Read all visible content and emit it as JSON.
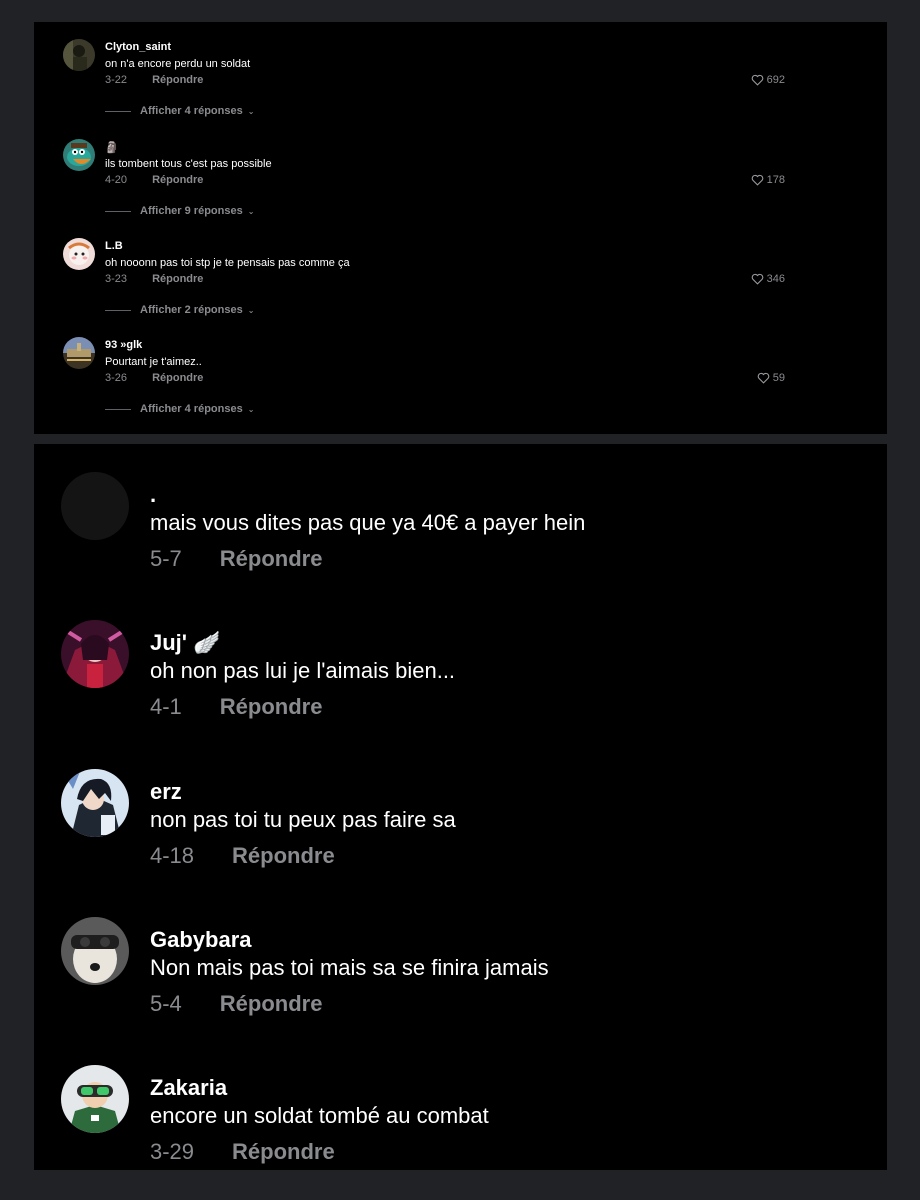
{
  "top_comments": [
    {
      "username": "Clyton_saint",
      "text": "on n'a encore perdu un soldat",
      "date": "3-22",
      "reply_label": "Répondre",
      "likes": "692",
      "replies_label": "Afficher 4 réponses"
    },
    {
      "username": "🗿",
      "text": "ils tombent tous c'est pas possible",
      "date": "4-20",
      "reply_label": "Répondre",
      "likes": "178",
      "replies_label": "Afficher 9 réponses"
    },
    {
      "username": "L.B",
      "text": "oh nooonn pas toi stp je te pensais pas comme ça",
      "date": "3-23",
      "reply_label": "Répondre",
      "likes": "346",
      "replies_label": "Afficher 2 réponses"
    },
    {
      "username": "93 »glk",
      "text": "Pourtant je t'aimez..",
      "date": "3-26",
      "reply_label": "Répondre",
      "likes": "59",
      "replies_label": "Afficher 4 réponses"
    }
  ],
  "bottom_comments": [
    {
      "username": ".",
      "text": "mais vous dites pas que ya 40€ a payer hein",
      "date": "5-7",
      "reply_label": "Répondre"
    },
    {
      "username": "Juj' 🪽",
      "text": "oh non pas lui je l'aimais bien...",
      "date": "4-1",
      "reply_label": "Répondre"
    },
    {
      "username": "erz",
      "text": "non pas toi tu peux pas faire sa",
      "date": "4-18",
      "reply_label": "Répondre"
    },
    {
      "username": "Gabybara",
      "text": "Non mais pas toi mais sa se finira jamais",
      "date": "5-4",
      "reply_label": "Répondre"
    },
    {
      "username": "Zakaria",
      "text": "encore un soldat tombé au combat",
      "date": "3-29",
      "reply_label": "Répondre"
    }
  ],
  "colors": {
    "page_background": "#212226",
    "panel_background": "#000000",
    "secondary_text": "#8a8b8f"
  },
  "icons": {
    "like": "heart-outline-icon",
    "expand": "chevron-down-icon"
  }
}
